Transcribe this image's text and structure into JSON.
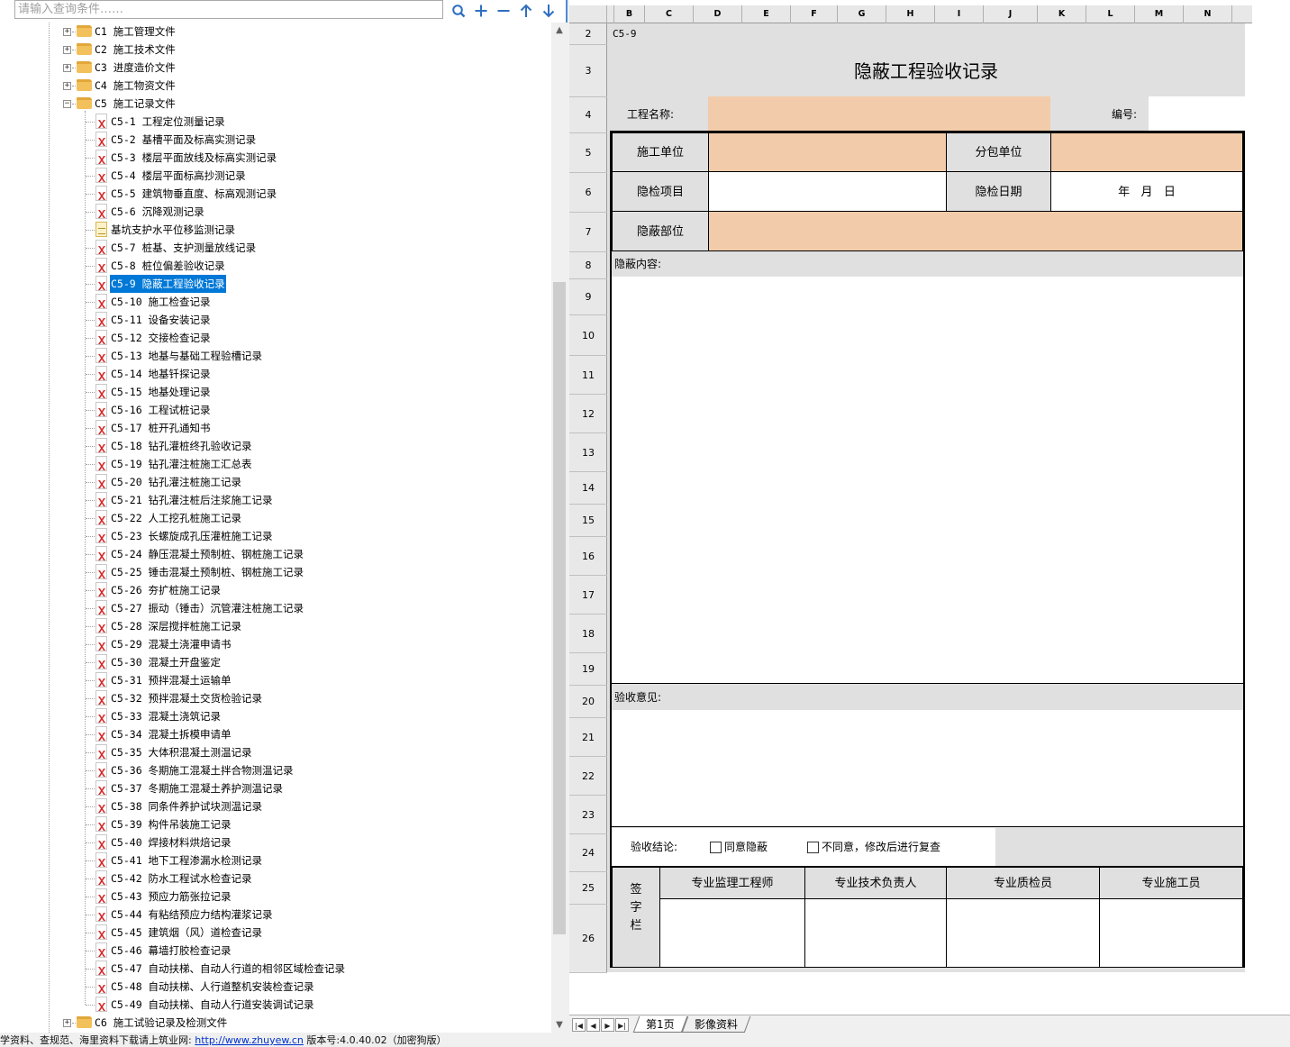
{
  "search": {
    "placeholder": "请输入查询条件……"
  },
  "toolbar": [
    {
      "name": "search-button",
      "icon": "search-icon"
    },
    {
      "name": "expand-all-button",
      "icon": "plus-icon"
    },
    {
      "name": "collapse-all-button",
      "icon": "minus-icon"
    },
    {
      "name": "move-up-button",
      "icon": "arrow-up-icon"
    },
    {
      "name": "move-down-button",
      "icon": "arrow-down-icon"
    }
  ],
  "tree": {
    "folders": [
      {
        "label": "C1 施工管理文件",
        "expanded": false
      },
      {
        "label": "C2 施工技术文件",
        "expanded": false
      },
      {
        "label": "C3 进度造价文件",
        "expanded": false
      },
      {
        "label": "C4 施工物资文件",
        "expanded": false
      },
      {
        "label": "C5 施工记录文件",
        "expanded": true
      }
    ],
    "children": [
      {
        "label": "C5-1 工程定位测量记录",
        "icon": "excel-file-icon"
      },
      {
        "label": "C5-2 基槽平面及标高实测记录",
        "icon": "excel-file-icon"
      },
      {
        "label": "C5-3 楼层平面放线及标高实测记录",
        "icon": "excel-file-icon"
      },
      {
        "label": "C5-4 楼层平面标高抄测记录",
        "icon": "excel-file-icon"
      },
      {
        "label": "C5-5 建筑物垂直度、标高观测记录",
        "icon": "excel-file-icon"
      },
      {
        "label": "C5-6 沉降观测记录",
        "icon": "excel-file-icon"
      },
      {
        "label": "基坑支护水平位移监测记录",
        "icon": "doc-file-icon"
      },
      {
        "label": "C5-7 桩基、支护测量放线记录",
        "icon": "excel-file-icon"
      },
      {
        "label": "C5-8 桩位偏差验收记录",
        "icon": "excel-file-icon"
      },
      {
        "label": "C5-9 隐蔽工程验收记录",
        "icon": "excel-file-icon",
        "selected": true
      },
      {
        "label": "C5-10 施工检查记录",
        "icon": "excel-file-icon"
      },
      {
        "label": "C5-11 设备安装记录",
        "icon": "excel-file-icon"
      },
      {
        "label": "C5-12 交接检查记录",
        "icon": "excel-file-icon"
      },
      {
        "label": "C5-13 地基与基础工程验槽记录",
        "icon": "excel-file-icon"
      },
      {
        "label": "C5-14 地基钎探记录",
        "icon": "excel-file-icon"
      },
      {
        "label": "C5-15 地基处理记录",
        "icon": "excel-file-icon"
      },
      {
        "label": "C5-16 工程试桩记录",
        "icon": "excel-file-icon"
      },
      {
        "label": "C5-17 桩开孔通知书",
        "icon": "excel-file-icon"
      },
      {
        "label": "C5-18 钻孔灌桩终孔验收记录",
        "icon": "excel-file-icon"
      },
      {
        "label": "C5-19 钻孔灌注桩施工汇总表",
        "icon": "excel-file-icon"
      },
      {
        "label": "C5-20 钻孔灌注桩施工记录",
        "icon": "excel-file-icon"
      },
      {
        "label": "C5-21 钻孔灌注桩后注浆施工记录",
        "icon": "excel-file-icon"
      },
      {
        "label": "C5-22 人工挖孔桩施工记录",
        "icon": "excel-file-icon"
      },
      {
        "label": "C5-23 长螺旋成孔压灌桩施工记录",
        "icon": "excel-file-icon"
      },
      {
        "label": "C5-24 静压混凝土预制桩、钢桩施工记录",
        "icon": "excel-file-icon"
      },
      {
        "label": "C5-25 锤击混凝土预制桩、钢桩施工记录",
        "icon": "excel-file-icon"
      },
      {
        "label": "C5-26 夯扩桩施工记录",
        "icon": "excel-file-icon"
      },
      {
        "label": "C5-27 振动（锤击）沉管灌注桩施工记录",
        "icon": "excel-file-icon"
      },
      {
        "label": "C5-28 深层搅拌桩施工记录",
        "icon": "excel-file-icon"
      },
      {
        "label": "C5-29 混凝土浇灌申请书",
        "icon": "excel-file-icon"
      },
      {
        "label": "C5-30 混凝土开盘鉴定",
        "icon": "excel-file-icon"
      },
      {
        "label": "C5-31 预拌混凝土运输单",
        "icon": "excel-file-icon"
      },
      {
        "label": "C5-32 预拌混凝土交货检验记录",
        "icon": "excel-file-icon"
      },
      {
        "label": "C5-33 混凝土浇筑记录",
        "icon": "excel-file-icon"
      },
      {
        "label": "C5-34 混凝土拆模申请单",
        "icon": "excel-file-icon"
      },
      {
        "label": "C5-35 大体积混凝土测温记录",
        "icon": "excel-file-icon"
      },
      {
        "label": "C5-36 冬期施工混凝土拌合物测温记录",
        "icon": "excel-file-icon"
      },
      {
        "label": "C5-37 冬期施工混凝土养护测温记录",
        "icon": "excel-file-icon"
      },
      {
        "label": "C5-38 同条件养护试块测温记录",
        "icon": "excel-file-icon"
      },
      {
        "label": "C5-39 构件吊装施工记录",
        "icon": "excel-file-icon"
      },
      {
        "label": "C5-40 焊接材料烘焙记录",
        "icon": "excel-file-icon"
      },
      {
        "label": "C5-41 地下工程渗漏水检测记录",
        "icon": "excel-file-icon"
      },
      {
        "label": "C5-42 防水工程试水检查记录",
        "icon": "excel-file-icon"
      },
      {
        "label": "C5-43 预应力筋张拉记录",
        "icon": "excel-file-icon"
      },
      {
        "label": "C5-44 有粘结预应力结构灌浆记录",
        "icon": "excel-file-icon"
      },
      {
        "label": "C5-45 建筑烟（风）道检查记录",
        "icon": "excel-file-icon"
      },
      {
        "label": "C5-46 幕墙打胶检查记录",
        "icon": "excel-file-icon"
      },
      {
        "label": "C5-47 自动扶梯、自动人行道的相邻区域检查记录",
        "icon": "excel-file-icon"
      },
      {
        "label": "C5-48 自动扶梯、人行道整机安装检查记录",
        "icon": "excel-file-icon"
      },
      {
        "label": "C5-49 自动扶梯、自动人行道安装调试记录",
        "icon": "excel-file-icon"
      }
    ],
    "trailing_folder": {
      "label": "C6 施工试验记录及检测文件",
      "expanded": false
    }
  },
  "sheet": {
    "columns": [
      "B",
      "C",
      "D",
      "E",
      "F",
      "G",
      "H",
      "I",
      "J",
      "K",
      "L",
      "M",
      "N"
    ],
    "rows": [
      "2",
      "3",
      "4",
      "5",
      "6",
      "7",
      "8",
      "9",
      "10",
      "11",
      "12",
      "13",
      "14",
      "15",
      "16",
      "17",
      "18",
      "19",
      "20",
      "21",
      "22",
      "23",
      "24",
      "25",
      "26"
    ],
    "form": {
      "code": "C5-9",
      "title": "隐蔽工程验收记录",
      "project_name_label": "工程名称:",
      "serial_label": "编号:",
      "contractor_label": "施工单位",
      "subcontractor_label": "分包单位",
      "inspect_item_label": "隐检项目",
      "inspect_date_label": "隐检日期",
      "date_placeholder": "年   月   日",
      "concealed_part_label": "隐蔽部位",
      "concealed_content_label": "隐蔽内容:",
      "acceptance_opinion_label": "验收意见:",
      "conclusion_label": "验收结论:",
      "option_agree": "同意隐蔽",
      "option_disagree": "不同意，修改后进行复查",
      "sign_label": "签字栏",
      "signers": [
        "专业监理工程师",
        "专业技术负责人",
        "专业质检员",
        "专业施工员"
      ]
    }
  },
  "sheet_tabs": [
    {
      "label": "第1页",
      "active": true
    },
    {
      "label": "影像资料",
      "active": false
    }
  ],
  "status": {
    "text_before": "学资料、查规范、海里资料下载请上筑业网:",
    "url": "http://www.zhuyew.cn",
    "text_after": "版本号:4.0.40.02（加密狗版）"
  },
  "colors": {
    "accent": "#0078d7",
    "peach": "#f2ccaa",
    "grey": "#e0e0e0"
  }
}
